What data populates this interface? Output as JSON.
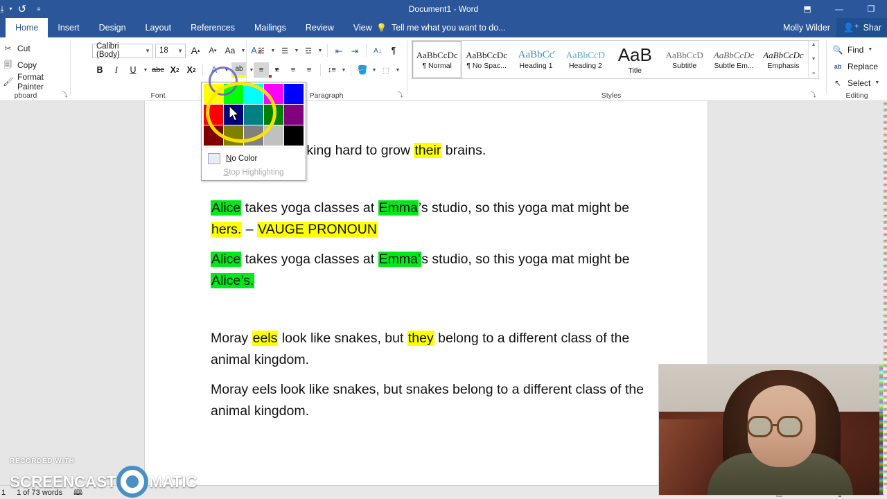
{
  "titlebar": {
    "document_title": "Document1 - Word",
    "quick_access": [
      {
        "name": "save-icon",
        "glyph": "⬇"
      },
      {
        "name": "undo-icon",
        "glyph": "↺"
      },
      {
        "name": "customize-qat-icon",
        "glyph": "☰"
      }
    ],
    "window_controls": [
      {
        "name": "ribbon-display-options-icon",
        "glyph": "⬒"
      },
      {
        "name": "minimize-icon",
        "glyph": "—"
      },
      {
        "name": "restore-icon",
        "glyph": "❐"
      }
    ]
  },
  "tabs": [
    {
      "label": "Home",
      "active": true
    },
    {
      "label": "Insert",
      "active": false
    },
    {
      "label": "Design",
      "active": false
    },
    {
      "label": "Layout",
      "active": false
    },
    {
      "label": "References",
      "active": false
    },
    {
      "label": "Mailings",
      "active": false
    },
    {
      "label": "Review",
      "active": false
    },
    {
      "label": "View",
      "active": false
    }
  ],
  "tell_me": {
    "label": "Tell me what you want to do...",
    "icon": "lightbulb-icon"
  },
  "account": {
    "user_name": "Molly Wilder",
    "share_label": "Shar",
    "share_icon": "person-add-icon"
  },
  "ribbon": {
    "groups": [
      {
        "name": "clipboard",
        "label": "pboard"
      },
      {
        "name": "font",
        "label": "Font"
      },
      {
        "name": "paragraph",
        "label": "Paragraph"
      },
      {
        "name": "styles",
        "label": "Styles"
      },
      {
        "name": "editing",
        "label": "Editing"
      }
    ],
    "clipboard": {
      "items": [
        {
          "label": "Cut",
          "icon": "scissors-icon",
          "glyph": "✂"
        },
        {
          "label": "Copy",
          "icon": "copy-icon",
          "glyph": "❐"
        },
        {
          "label": "Format Painter",
          "icon": "format-painter-icon",
          "glyph": "✐"
        }
      ]
    },
    "font": {
      "font_name": "Calibri (Body)",
      "font_size": "18",
      "buttons": [
        {
          "name": "grow-font-button",
          "glyph": "A˄"
        },
        {
          "name": "shrink-font-button",
          "glyph": "A˅"
        },
        {
          "name": "change-case-button",
          "glyph": "Aa"
        },
        {
          "name": "clear-formatting-button",
          "glyph": "A✗"
        },
        {
          "name": "bold-button",
          "glyph": "B"
        },
        {
          "name": "italic-button",
          "glyph": "I"
        },
        {
          "name": "underline-button",
          "glyph": "U"
        },
        {
          "name": "strikethrough-button",
          "glyph": "abc"
        },
        {
          "name": "subscript-button",
          "glyph": "X₂"
        },
        {
          "name": "superscript-button",
          "glyph": "X²"
        },
        {
          "name": "text-effects-button",
          "glyph": "A"
        },
        {
          "name": "text-highlight-color-button",
          "glyph": "ab"
        },
        {
          "name": "font-color-button",
          "glyph": "A"
        }
      ]
    },
    "paragraph": {
      "buttons": [
        {
          "name": "bullets-button",
          "glyph": "≡"
        },
        {
          "name": "numbering-button",
          "glyph": "≡"
        },
        {
          "name": "multilevel-list-button",
          "glyph": "≡"
        },
        {
          "name": "decrease-indent-button",
          "glyph": "⇤"
        },
        {
          "name": "increase-indent-button",
          "glyph": "⇥"
        },
        {
          "name": "sort-button",
          "glyph": "A↓"
        },
        {
          "name": "show-formatting-marks-button",
          "glyph": "¶"
        },
        {
          "name": "align-left-button",
          "glyph": "≡"
        },
        {
          "name": "align-center-button",
          "glyph": "≡"
        },
        {
          "name": "align-right-button",
          "glyph": "≡"
        },
        {
          "name": "justify-button",
          "glyph": "≡"
        },
        {
          "name": "line-spacing-button",
          "glyph": "↕"
        },
        {
          "name": "shading-button",
          "glyph": "◧"
        },
        {
          "name": "borders-button",
          "glyph": "⬚"
        }
      ]
    },
    "styles": {
      "items": [
        {
          "preview": "AaBbCcDc",
          "name": "¶ Normal",
          "selected": true
        },
        {
          "preview": "AaBbCcDc",
          "name": "¶ No Spac...",
          "selected": false
        },
        {
          "preview": "AaBbCƈ",
          "name": "Heading 1",
          "selected": false
        },
        {
          "preview": "AaBbCcD",
          "name": "Heading 2",
          "selected": false
        },
        {
          "preview": "AaB",
          "name": "Title",
          "selected": false
        },
        {
          "preview": "AaBbCcD",
          "name": "Subtitle",
          "selected": false
        },
        {
          "preview": "AaBbCcDc",
          "name": "Subtle Em...",
          "selected": false
        },
        {
          "preview": "AaBbCcDc",
          "name": "Emphasis",
          "selected": false
        }
      ]
    },
    "editing": {
      "items": [
        {
          "label": "Find",
          "icon": "search-icon",
          "glyph": "⌕",
          "has_caret": true
        },
        {
          "label": "Replace",
          "icon": "replace-icon",
          "glyph": "ab",
          "has_caret": false
        },
        {
          "label": "Select",
          "icon": "select-cursor-icon",
          "glyph": "↖",
          "has_caret": true
        }
      ]
    }
  },
  "highlight_panel": {
    "swatches": [
      {
        "name": "yellow",
        "hex": "#ffff00"
      },
      {
        "name": "bright-green",
        "hex": "#00ff00"
      },
      {
        "name": "turquoise",
        "hex": "#00ffff"
      },
      {
        "name": "pink",
        "hex": "#ff00ff"
      },
      {
        "name": "blue",
        "hex": "#0000ff"
      },
      {
        "name": "red",
        "hex": "#ff0000"
      },
      {
        "name": "dark-blue",
        "hex": "#000080"
      },
      {
        "name": "teal",
        "hex": "#008080"
      },
      {
        "name": "green",
        "hex": "#008000"
      },
      {
        "name": "violet",
        "hex": "#800080"
      },
      {
        "name": "dark-red",
        "hex": "#800000"
      },
      {
        "name": "dark-yellow",
        "hex": "#808000"
      },
      {
        "name": "gray-50",
        "hex": "#808080"
      },
      {
        "name": "gray-25",
        "hex": "#c0c0c0"
      },
      {
        "name": "black",
        "hex": "#000000"
      }
    ],
    "no_color_label": "No Color",
    "no_color_accel": "N",
    "stop_highlighting_label": "top Highlighting",
    "stop_highlighting_accel": "S"
  },
  "document": {
    "paragraphs": [
      {
        "id": "p1",
        "runs": [
          {
            "text": "PP Indy are working hard to grow ",
            "hl": "none"
          },
          {
            "text": "their",
            "hl": "yellow"
          },
          {
            "text": " brains.",
            "hl": "none"
          }
        ]
      },
      {
        "id": "p2",
        "runs": [
          {
            "text": "Alice",
            "hl": "green"
          },
          {
            "text": " takes yoga classes at ",
            "hl": "none"
          },
          {
            "text": "Emma",
            "hl": "green"
          },
          {
            "text": "’s studio, so this yoga mat might be ",
            "hl": "none"
          },
          {
            "text": "hers.",
            "hl": "yellow"
          },
          {
            "text": " – ",
            "hl": "none"
          },
          {
            "text": "VAUGE PRONOUN",
            "hl": "yellow"
          }
        ]
      },
      {
        "id": "p3",
        "runs": [
          {
            "text": "Alice",
            "hl": "green"
          },
          {
            "text": " takes yoga classes at ",
            "hl": "none"
          },
          {
            "text": "Emma’",
            "hl": "green"
          },
          {
            "text": "s studio, so this yoga mat might be ",
            "hl": "none"
          },
          {
            "text": "Alice’s.",
            "hl": "green"
          }
        ]
      },
      {
        "id": "p4",
        "runs": [
          {
            "text": "Moray ",
            "hl": "none"
          },
          {
            "text": "eels",
            "hl": "yellow"
          },
          {
            "text": " look like snakes, but ",
            "hl": "none"
          },
          {
            "text": "they",
            "hl": "yellow"
          },
          {
            "text": " belong to a different class of the animal kingdom.",
            "hl": "none"
          }
        ]
      },
      {
        "id": "p5",
        "runs": [
          {
            "text": "Moray eels look like snakes, but snakes belong to a different class of the animal kingdom.",
            "hl": "none"
          }
        ]
      }
    ]
  },
  "statusbar": {
    "page_number": "1",
    "word_count": "1 of 73 words",
    "proofing_icon": "spellcheck-icon",
    "views": [
      {
        "name": "read-mode-button",
        "glyph": "☰"
      },
      {
        "name": "print-layout-button",
        "glyph": "▤"
      },
      {
        "name": "web-layout-button",
        "glyph": "⌗"
      }
    ],
    "zoom_level": "1"
  },
  "watermark": {
    "top_line": "RECORDED WITH",
    "word_left": "SCREENCAST",
    "word_right": "MATIC",
    "logo_icon": "screencast-o-matic-logo-icon"
  },
  "annotations": {
    "purple_circle": "highlight-dropdown-annotation",
    "yellow_circle": "color-swatch-annotation",
    "cursor": "mouse-pointer"
  },
  "colors": {
    "ribbon_blue": "#2b579a",
    "highlight_yellow": "#ffff00",
    "highlight_green": "#00e919",
    "annot_purple": "#6a63c9",
    "annot_yellow": "#ffe600"
  }
}
